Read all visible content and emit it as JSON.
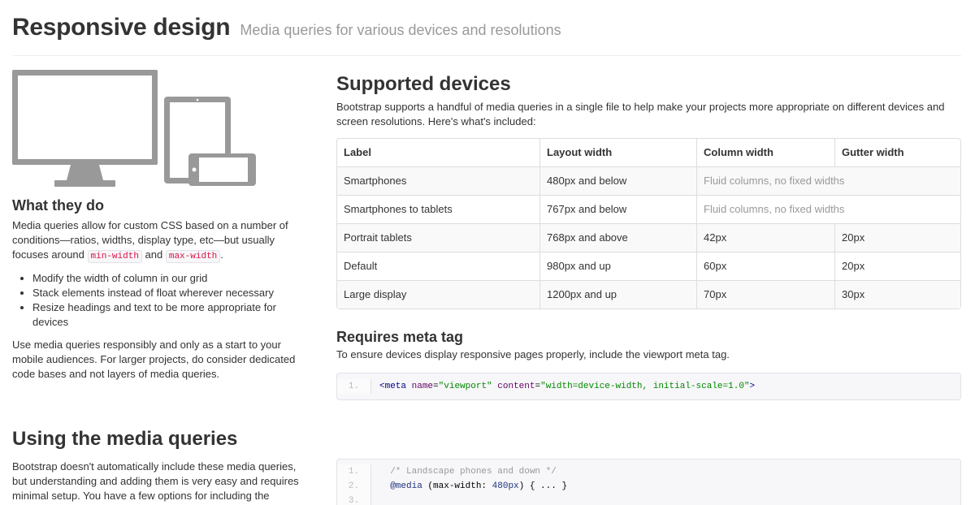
{
  "header": {
    "title": "Responsive design",
    "subtitle": "Media queries for various devices and resolutions"
  },
  "illustration": {
    "name": "devices-illustration",
    "colors": {
      "device": "#999999",
      "screen": "#ffffff"
    }
  },
  "what_they_do": {
    "heading": "What they do",
    "intro_before": "Media queries allow for custom CSS based on a number of conditions—ratios, widths, display type, etc—but usually focuses around ",
    "code1": "min-width",
    "and": " and ",
    "code2": "max-width",
    "period": ".",
    "bullets": [
      "Modify the width of column in our grid",
      "Stack elements instead of float wherever necessary",
      "Resize headings and text to be more appropriate for devices"
    ],
    "outro": "Use media queries responsibly and only as a start to your mobile audiences. For larger projects, do consider dedicated code bases and not layers of media queries."
  },
  "supported": {
    "heading": "Supported devices",
    "description": "Bootstrap supports a handful of media queries in a single file to help make your projects more appropriate on different devices and screen resolutions. Here's what's included:",
    "columns": [
      "Label",
      "Layout width",
      "Column width",
      "Gutter width"
    ],
    "rows": [
      [
        "Smartphones",
        "480px and below",
        "Fluid columns, no fixed widths",
        ""
      ],
      [
        "Smartphones to tablets",
        "767px and below",
        "Fluid columns, no fixed widths",
        ""
      ],
      [
        "Portrait tablets",
        "768px and above",
        "42px",
        "20px"
      ],
      [
        "Default",
        "980px and up",
        "60px",
        "20px"
      ],
      [
        "Large display",
        "1200px and up",
        "70px",
        "30px"
      ]
    ]
  },
  "meta_tag": {
    "heading": "Requires meta tag",
    "description": "To ensure devices display responsive pages properly, include the viewport meta tag.",
    "line_number": "1.",
    "code": {
      "open": "<meta",
      "attr1": "name",
      "eq1": "=",
      "val1": "\"viewport\"",
      "attr2": "content",
      "eq2": "=",
      "val2": "\"width=device-width, initial-scale=1.0\"",
      "close": ">"
    }
  },
  "using": {
    "heading": "Using the media queries",
    "description": "Bootstrap doesn't automatically include these media queries, but understanding and adding them is very easy and requires minimal setup. You have a few options for including the"
  },
  "media_code": {
    "lines": [
      {
        "n": "1.",
        "comment": "/* Landscape phones and down */"
      },
      {
        "n": "2.",
        "kw": "@media",
        "rest": " (max-width: ",
        "num": "480px",
        "end": ") { ... }"
      },
      {
        "n": "3."
      }
    ]
  }
}
